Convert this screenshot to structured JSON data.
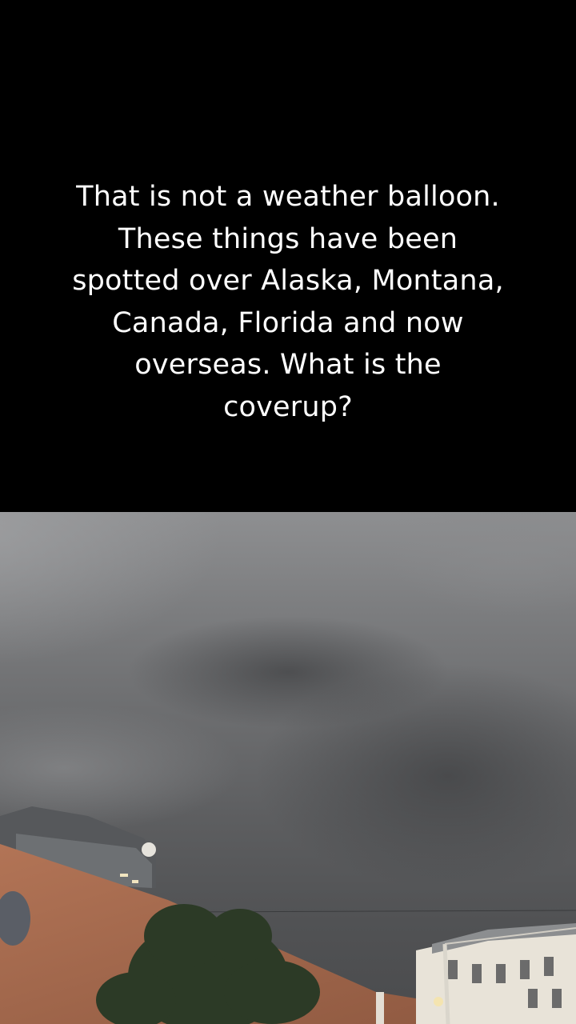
{
  "caption": {
    "text": "That is not a weather balloon.  These things have been spotted over Alaska, Montana, Canada, Florida and now overseas.  What is the coverup?"
  },
  "video": {
    "scene": "overcast-sky-with-buildings"
  },
  "colors": {
    "background": "#000000",
    "caption_text": "#ffffff",
    "sky": "#6c6d6f",
    "rooftop": "#a56b4f"
  }
}
